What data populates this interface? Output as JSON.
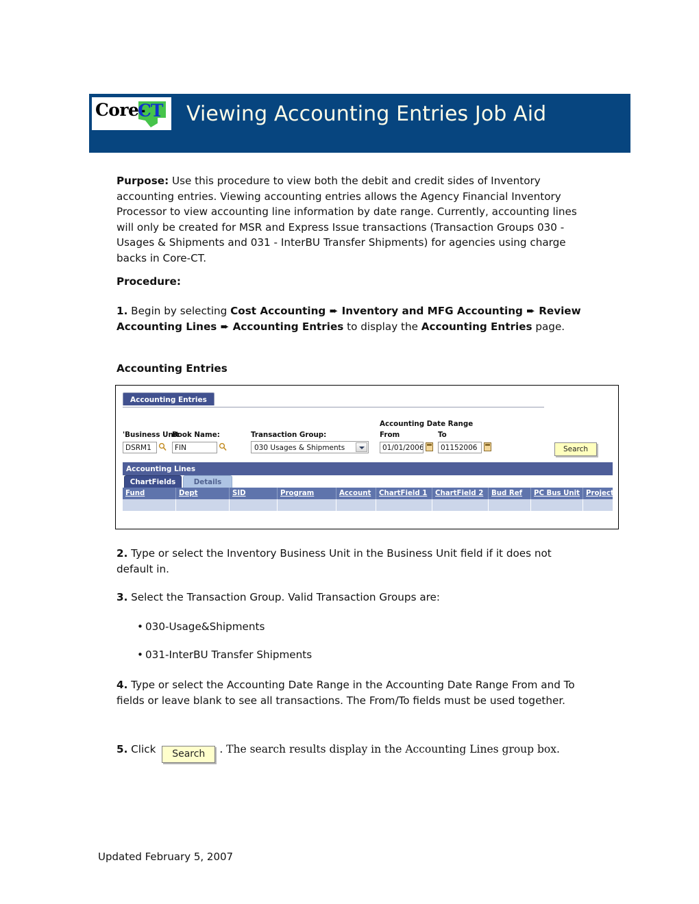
{
  "header": {
    "title": "Viewing Accounting Entries Job Aid",
    "logo_core": "Core-",
    "logo_ct": "CT",
    "banner_color": "#07457f",
    "title_color": "#fffde8"
  },
  "document": {
    "purpose_label": "Purpose:",
    "purpose_text": "  Use this procedure to view both the debit and credit sides of Inventory accounting entries. Viewing accounting entries allows the Agency Financial Inventory Processor to view accounting line information by date range. Currently, accounting lines will only be created for MSR and Express Issue transactions (Transaction Groups 030 - Usages & Shipments and 031 - InterBU Transfer Shipments) for agencies using charge backs in Core-CT.",
    "procedure_heading": "Procedure:",
    "step1_number": "1.",
    "step1_lead": " Begin by selecting ",
    "step1_path1": "Cost Accounting",
    "step1_arrow1": " ➨ ",
    "step1_path2": "Inventory and MFG Accounting",
    "step1_arrow2": " ➨ ",
    "step1_path3": "Review Accounting Lines",
    "step1_arrow3": " ➨ ",
    "step1_path4": "Accounting Entries",
    "step1_mid": " to display the ",
    "step1_path5": "Accounting Entries",
    "step1_tail": " page.",
    "accounting_entries_heading": "Accounting Entries",
    "step2": "2. Type or select the Inventory Business Unit in the Business Unit field if it does not default in.",
    "step2_number": "2.",
    "step2_text": " Type or select the Inventory Business Unit in the Business Unit field if it does not default in.",
    "step3_number": "3.",
    "step3_text": " Select the Transaction Group. Valid Transaction Groups are:",
    "bullet1": "030-Usage&Shipments",
    "bullet2": "031-InterBU Transfer Shipments",
    "bullet_marker": "•",
    "step4_number": "4.",
    "step4_text": " Type or select the Accounting Date Range in the Accounting Date Range From and To fields or leave blank to see all transactions. The From/To fields must be used together.",
    "step5_number": "5.",
    "step5_lead": " Click ",
    "step5_button_label": "Search",
    "step5_tail": ". The search results display in the Accounting Lines group box.",
    "footer": "Updated February 5, 2007"
  },
  "screenshot": {
    "page_tab": "Accounting Entries",
    "fields": {
      "business_unit_label": "'Business Unit",
      "business_unit_value": "DSRM1",
      "book_name_label": "Book Name:",
      "book_name_value": "FIN",
      "transaction_group_label": "Transaction Group:",
      "transaction_group_value": "030 Usages & Shipments",
      "transaction_group_options": [
        "030 Usages & Shipments",
        "031 InterBU Transfer Shipments"
      ],
      "date_range_label": "Accounting Date Range",
      "from_label": "From",
      "from_value": "01/01/2006",
      "to_label": "To",
      "to_value": "01152006",
      "search_label": "Search"
    },
    "accounting_lines": {
      "group_title": "Accounting Lines",
      "tabs": [
        {
          "label": "ChartFields",
          "active": true
        },
        {
          "label": "Details",
          "active": false
        }
      ],
      "columns": [
        "Fund",
        "Dept",
        "SID",
        "Program",
        "Account",
        "ChartField 1",
        "ChartField 2",
        "Bud Ref",
        "PC Bus Unit",
        "Project"
      ],
      "rows": [
        [
          "",
          "",
          "",
          "",
          "",
          "",
          "",
          "",
          "",
          ""
        ]
      ]
    },
    "colors": {
      "tab_active": "#41518f",
      "group_bar": "#4e5e99",
      "grid_header": "#5f74ac",
      "grid_row": "#ccd6ea",
      "search_button": "#ffffbe"
    }
  }
}
